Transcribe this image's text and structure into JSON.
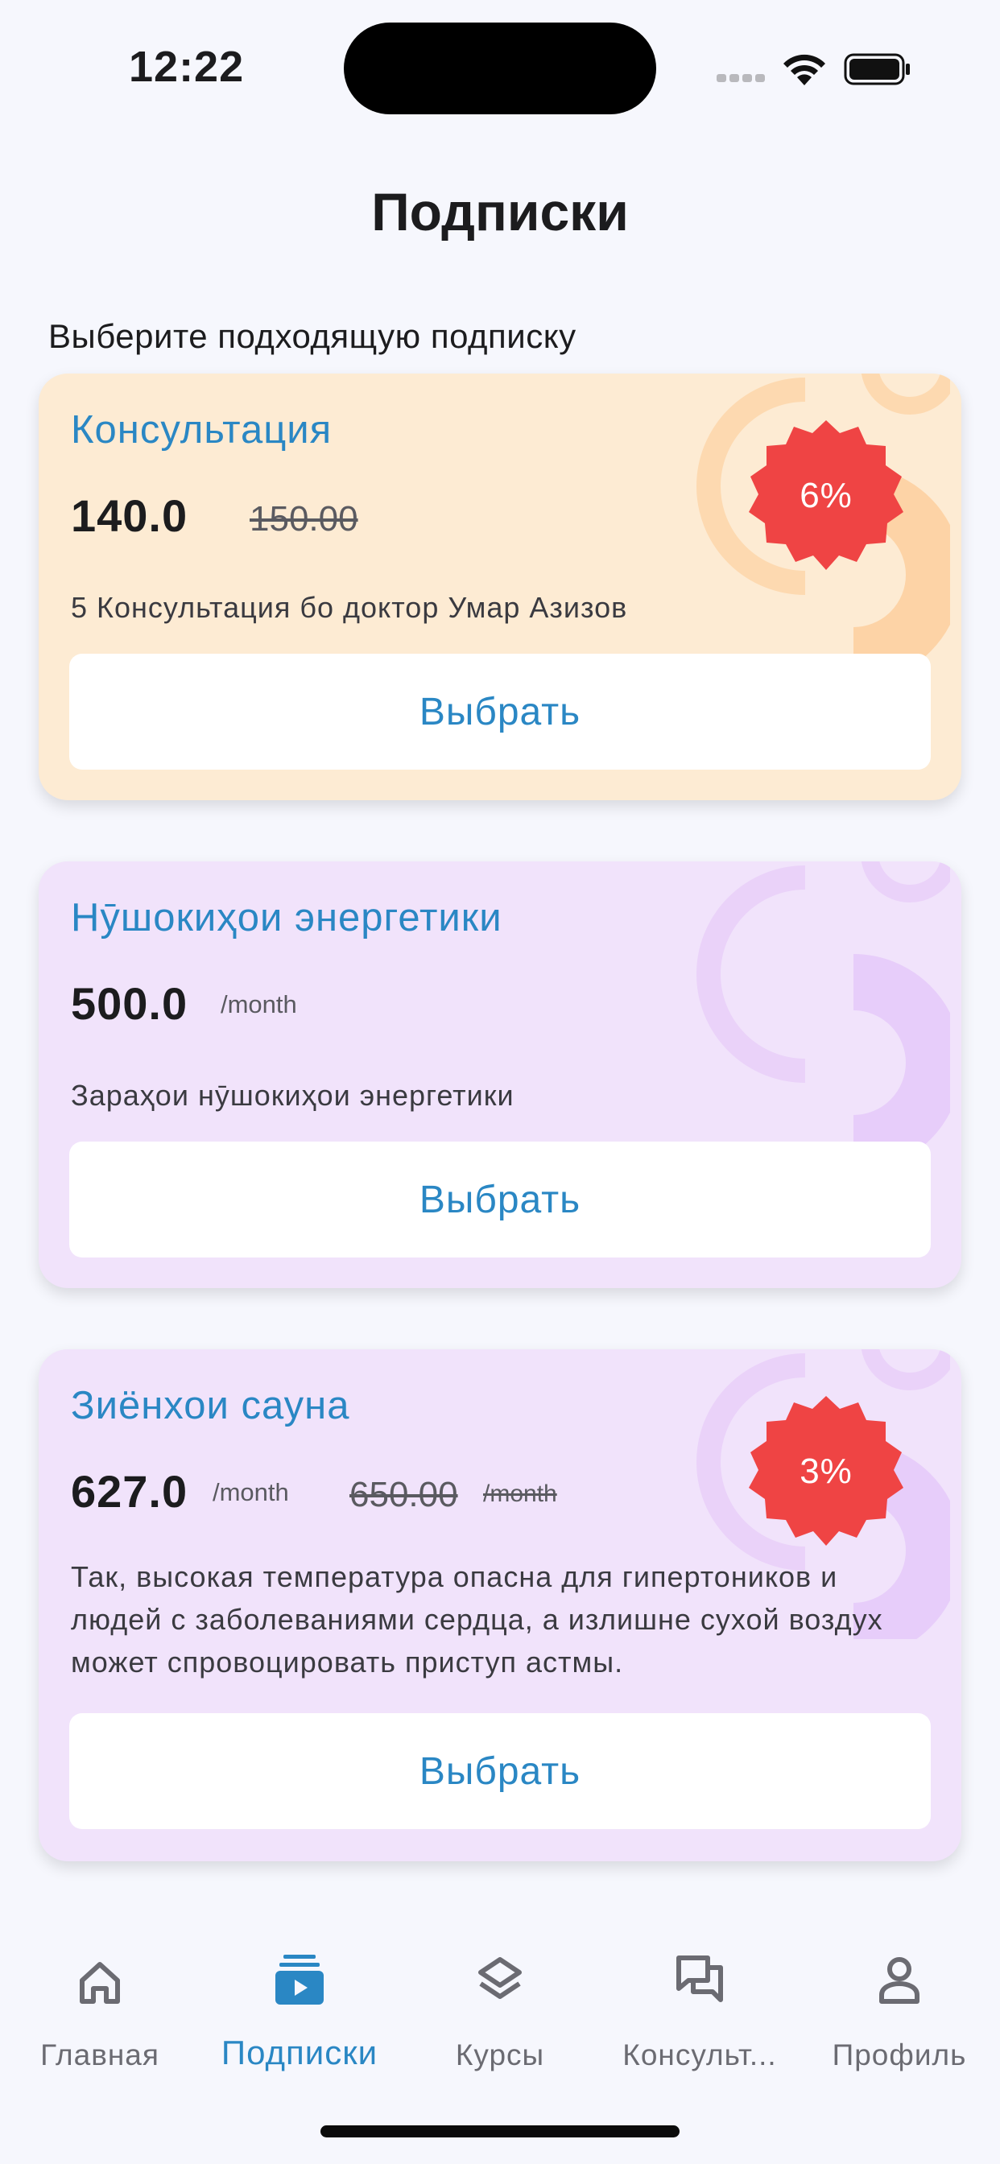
{
  "status_bar": {
    "time": "12:22"
  },
  "header": {
    "title": "Подписки",
    "subtitle": "Выберите подходящую подписку"
  },
  "cards": [
    {
      "title": "Консультация",
      "price": "140.0",
      "old_price": "150.00",
      "discount": "6%",
      "description": "5 Консультация бо доктор Умар Азизов",
      "button": "Выбрать",
      "theme": "orange"
    },
    {
      "title": "Нӯшокиҳои энергетики",
      "price": "500.0",
      "per": "/month",
      "description": "Зараҳои нӯшокиҳои энергетики",
      "button": "Выбрать",
      "theme": "purple"
    },
    {
      "title": "Зиёнхои сауна",
      "price": "627.0",
      "per": "/month",
      "old_price": "650.00",
      "old_per": "/month",
      "discount": "3%",
      "description": "Так, высокая температура опасна для гипертоников и людей с заболеваниями сердца, а излишне сухой воздух может спровоцировать приступ астмы.",
      "button": "Выбрать",
      "theme": "purple"
    }
  ],
  "bottom_nav": {
    "active_index": 1,
    "items": [
      {
        "label": "Главная",
        "icon": "home-icon"
      },
      {
        "label": "Подписки",
        "icon": "subscriptions-icon"
      },
      {
        "label": "Курсы",
        "icon": "layers-icon"
      },
      {
        "label": "Консульт...",
        "icon": "chat-icon"
      },
      {
        "label": "Профиль",
        "icon": "person-icon"
      }
    ]
  },
  "colors": {
    "accent": "#2a87c4",
    "badge": "#ef4444",
    "card_orange": "#fdebd3",
    "card_purple": "#f1e3fb"
  }
}
